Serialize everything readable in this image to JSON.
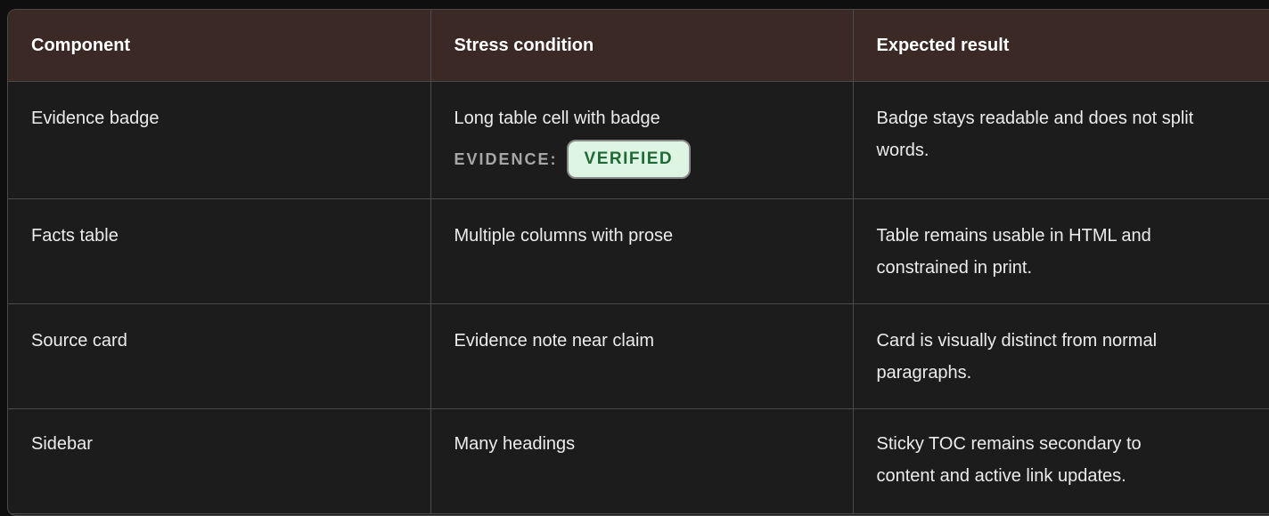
{
  "table": {
    "headers": [
      "Component",
      "Stress condition",
      "Expected result"
    ],
    "rows": [
      {
        "component": "Evidence badge",
        "condition": "Long table cell with badge",
        "badge_prefix": "EVIDENCE:",
        "badge_label": "VERIFIED",
        "expected": "Badge stays readable and does not split words."
      },
      {
        "component": "Facts table",
        "condition": "Multiple columns with prose",
        "expected": "Table remains usable in HTML and constrained in print."
      },
      {
        "component": "Source card",
        "condition": "Evidence note near claim",
        "expected": "Card is visually distinct from normal paragraphs."
      },
      {
        "component": "Sidebar",
        "condition": "Many headings",
        "expected": "Sticky TOC remains secondary to content and active link updates."
      }
    ]
  },
  "colors": {
    "header_bg": "#3a2924",
    "badge_bg": "#dff5e4",
    "badge_text": "#1f6a36"
  }
}
